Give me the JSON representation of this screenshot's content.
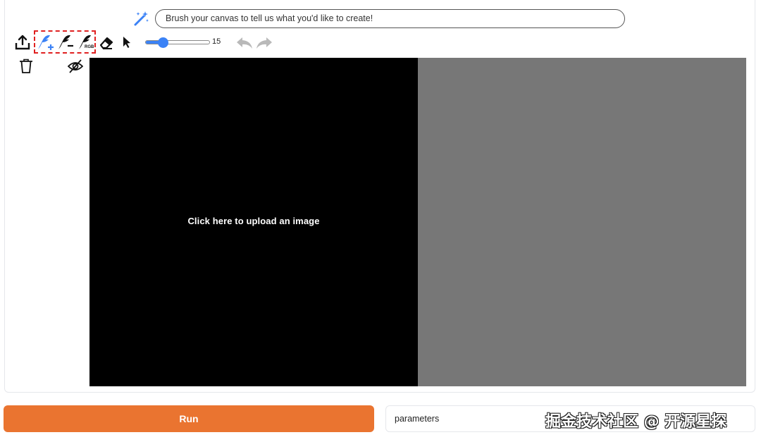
{
  "prompt": {
    "placeholder": "Brush your canvas to tell us what you'd like to create!",
    "icon": "magic-wand-icon"
  },
  "toolbar": {
    "tools": [
      {
        "name": "upload-icon"
      },
      {
        "name": "brush-add-icon",
        "selected": true
      },
      {
        "name": "brush-remove-icon",
        "selected": true
      },
      {
        "name": "brush-rgb-icon",
        "label": "RGB",
        "selected": true
      },
      {
        "name": "eraser-icon"
      },
      {
        "name": "pointer-icon"
      }
    ],
    "brush_size": {
      "value": "15",
      "fraction": 0.22
    },
    "undo": "undo-icon",
    "redo": "redo-icon",
    "accent": "#3b82f6"
  },
  "side_tools": {
    "delete": "trash-icon",
    "visibility": "eye-off-icon"
  },
  "canvas": {
    "upload_text": "Click here to upload an image",
    "left_color": "#000000",
    "right_color": "#777777"
  },
  "run": {
    "label": "Run",
    "color": "#ea7430"
  },
  "parameters": {
    "label": "parameters"
  },
  "watermark": "掘金技术社区 @ 开源星探"
}
